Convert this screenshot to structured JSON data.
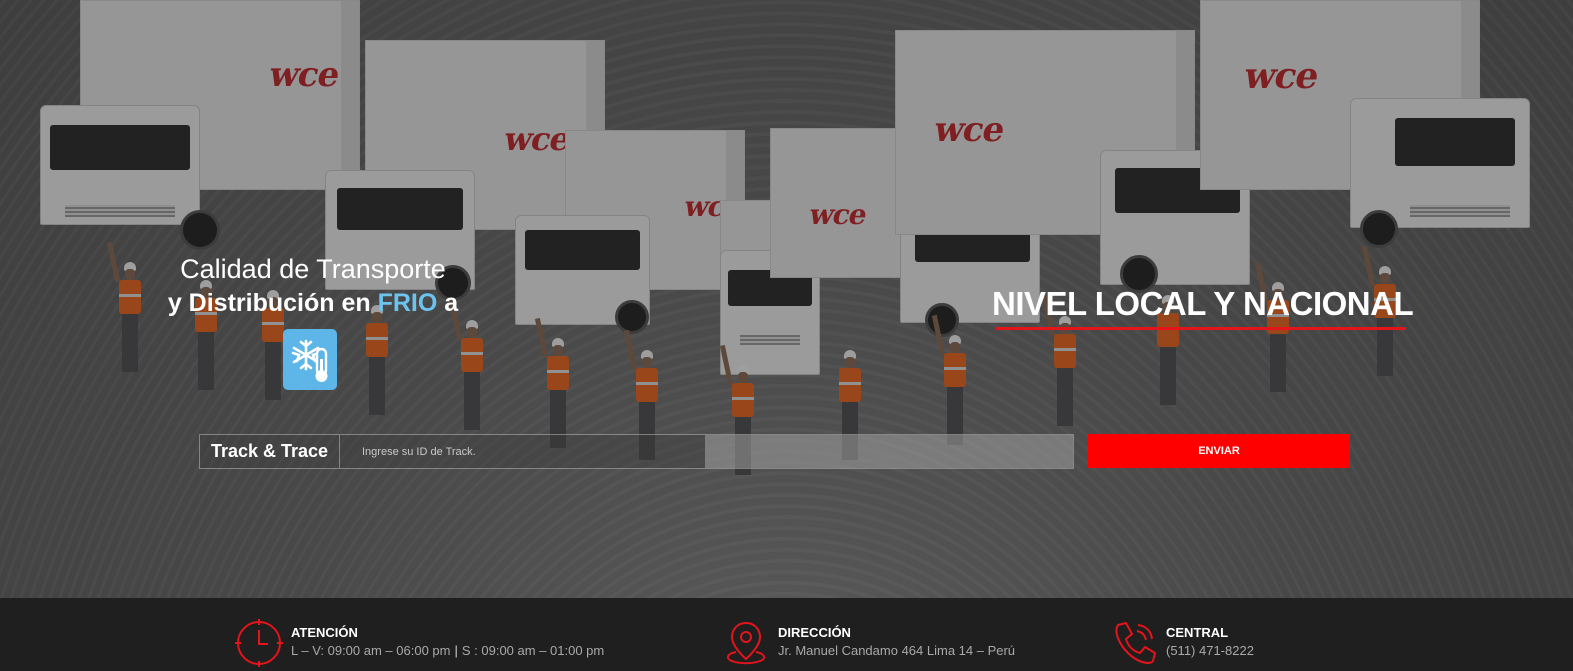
{
  "hero": {
    "headline_line1": "Calidad de Transporte",
    "headline_line2_a": "y Distribución en ",
    "headline_line2_frio": "FRIO",
    "headline_line2_b": " a",
    "headline_right": "NIVEL LOCAL Y NACIONAL",
    "badge_icon": "snowflake-thermometer-icon",
    "truck_brand": "wce"
  },
  "track": {
    "label": "Track & Trace",
    "placeholder": "Ingrese su ID de Track.",
    "value": "",
    "submit_label": "ENVIAR"
  },
  "info": {
    "attention": {
      "icon": "clock-icon",
      "title": "ATENCIÓN",
      "hours_weekdays": "L – V: 09:00 am – 06:00 pm",
      "separator": "|",
      "hours_saturday": "S : 09:00 am – 01:00 pm"
    },
    "address": {
      "icon": "map-pin-icon",
      "title": "DIRECCIÓN",
      "text": "Jr. Manuel Candamo 464 Lima 14 – Perú"
    },
    "phone": {
      "icon": "phone-icon",
      "title": "CENTRAL",
      "text": "(511) 471-8222"
    }
  },
  "colors": {
    "accent_red": "#ff0000",
    "frio_blue": "#6cc3ee",
    "bar_bg": "#1f1f1f"
  }
}
